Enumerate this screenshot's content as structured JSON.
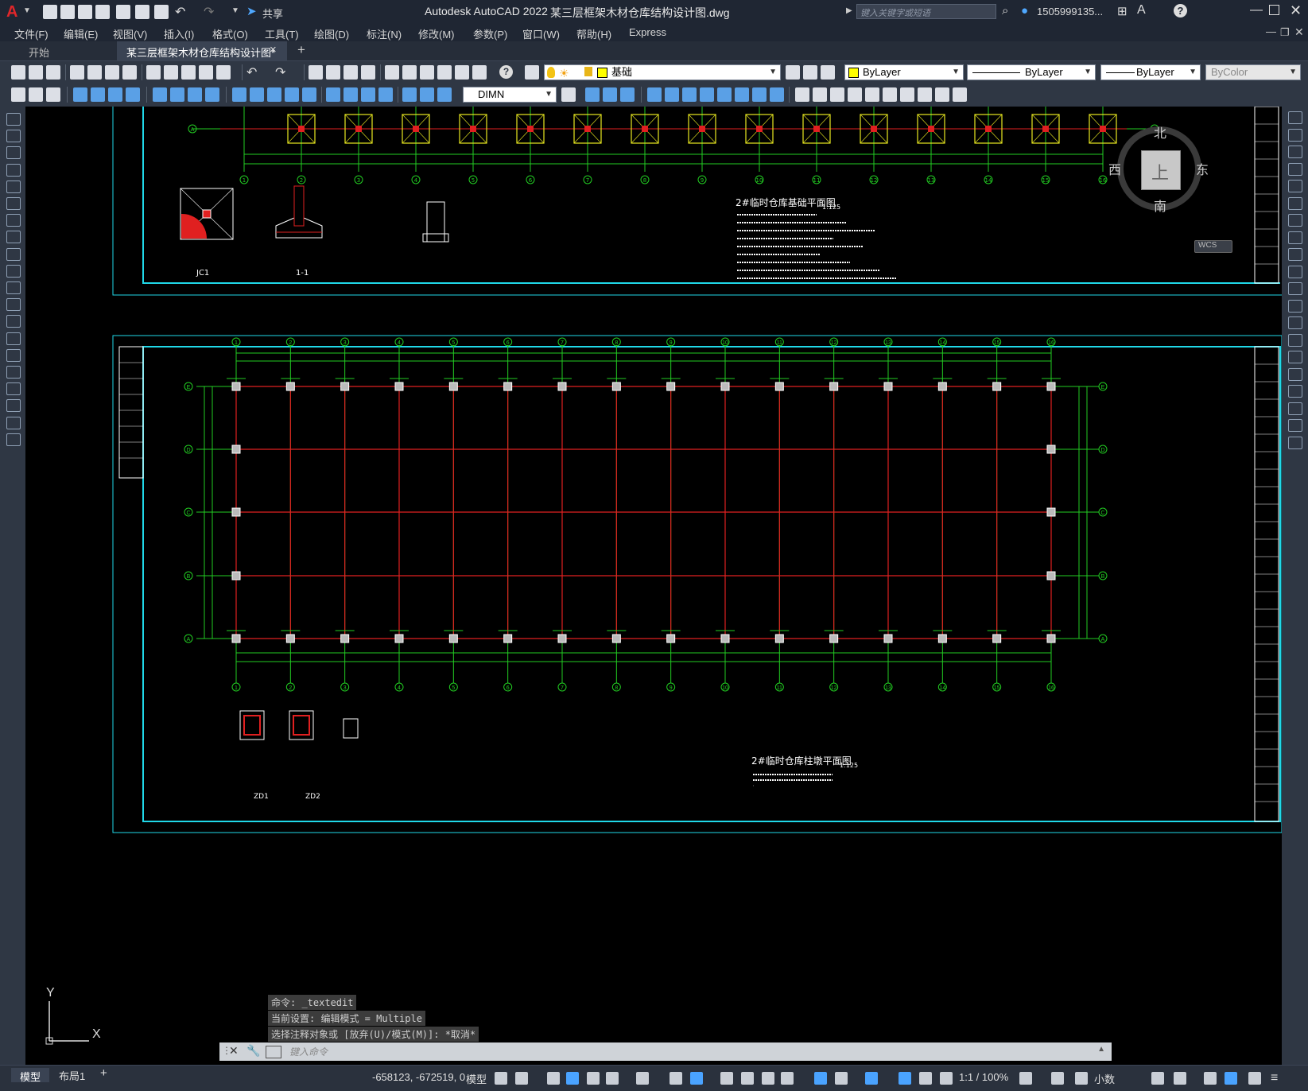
{
  "app": {
    "title": "Autodesk AutoCAD 2022",
    "file": "某三层框架木材仓库结构设计图.dwg",
    "search_placeholder": "键入关键字或短语",
    "user": "1505999135...",
    "share_label": "共享"
  },
  "menu": [
    "文件(F)",
    "编辑(E)",
    "视图(V)",
    "插入(I)",
    "格式(O)",
    "工具(T)",
    "绘图(D)",
    "标注(N)",
    "修改(M)",
    "参数(P)",
    "窗口(W)",
    "帮助(H)",
    "Express"
  ],
  "tabs": {
    "start": "开始",
    "active": "某三层框架木材仓库结构设计图*",
    "close": "×",
    "new": "+"
  },
  "toolbar": {
    "layer_value": "基础",
    "color_value": "ByLayer",
    "linetype_value": "ByLayer",
    "lineweight_value": "ByLayer",
    "plotstyle_value": "ByColor",
    "dimstyle_value": "DIMN"
  },
  "viewcube": {
    "north": "北",
    "south": "南",
    "east": "东",
    "west": "西",
    "face": "上",
    "wcs": "WCS"
  },
  "drawing": {
    "top_title": "2#临时仓库基础平面图",
    "top_scale": "1:125",
    "bottom_title": "2#临时仓库柱墩平面图",
    "bottom_scale": "1:125",
    "label_jc1": "JC1",
    "label_section": "1-1",
    "label_zd1": "ZD1",
    "label_zd2": "ZD2",
    "grid_numbers": [
      "1",
      "2",
      "3",
      "4",
      "5",
      "6",
      "7",
      "8",
      "9",
      "10",
      "11",
      "12",
      "13",
      "14",
      "15",
      "16"
    ],
    "grid_letters": [
      "E",
      "D",
      "C",
      "B",
      "A"
    ],
    "colors": {
      "grid_red": "#e02020",
      "dim_green": "#22cc22",
      "frame_cyan": "#20d8e8",
      "footing_yellow": "#e8e820"
    }
  },
  "ucs": {
    "y": "Y",
    "x": "X"
  },
  "command": {
    "lines": [
      "命令: _textedit",
      "当前设置: 编辑模式 = Multiple",
      "选择注释对象或 [放弃(U)/模式(M)]: *取消*"
    ],
    "placeholder": "键入命令"
  },
  "status": {
    "model_tab": "模型",
    "layout_tab": "布局1",
    "add_tab": "+",
    "coords": "-658123, -672519, 0",
    "mode": "模型",
    "scale": "1:1 / 100%",
    "units": "小数"
  }
}
